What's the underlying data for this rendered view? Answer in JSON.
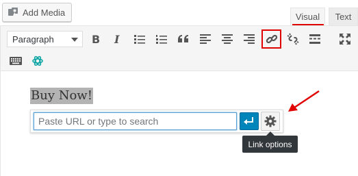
{
  "media": {
    "add_media_label": "Add Media"
  },
  "tabs": [
    {
      "label": "Visual",
      "active": true
    },
    {
      "label": "Text",
      "active": false
    }
  ],
  "toolbar": {
    "format_value": "Paragraph",
    "buttons_row1": [
      "bold-icon",
      "italic-icon",
      "bullet-list-icon",
      "numbered-list-icon",
      "blockquote-icon",
      "align-left-icon",
      "align-center-icon",
      "align-right-icon",
      "insert-link-icon",
      "unlink-icon",
      "read-more-icon",
      "fullscreen-icon"
    ],
    "buttons_row2": [
      "toolbar-toggle-icon",
      "ai-assistant-icon"
    ]
  },
  "content": {
    "selected_text": "Buy Now!"
  },
  "link_popup": {
    "placeholder": "Paste URL or type to search",
    "value": "",
    "tooltip": "Link options"
  },
  "colors": {
    "annotation_red": "#e00000",
    "apply_blue": "#0085ba",
    "ai_icon_teal": "#10a6a6"
  }
}
